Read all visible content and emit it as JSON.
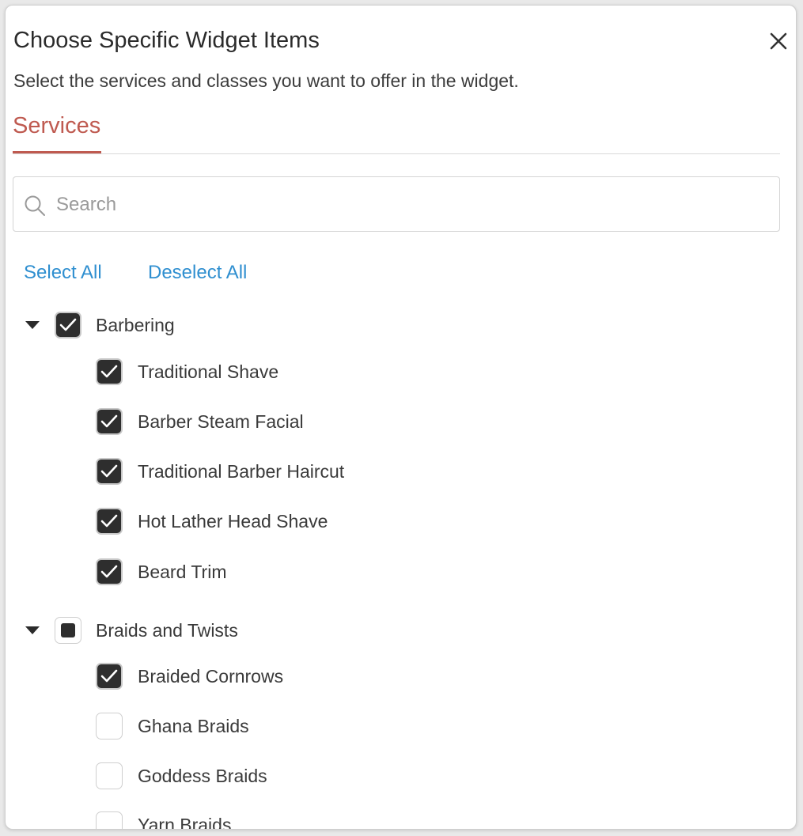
{
  "modal": {
    "title": "Choose Specific Widget Items",
    "subtitle": "Select the services and classes you want to offer in the widget.",
    "close_icon": "close-icon"
  },
  "tabs": [
    {
      "label": "Services",
      "active": true
    }
  ],
  "search": {
    "placeholder": "Search",
    "value": ""
  },
  "actions": {
    "select_all": "Select All",
    "deselect_all": "Deselect All"
  },
  "colors": {
    "accent": "#bf5a50",
    "link": "#2f8fd0",
    "checkbox_fill": "#2e2e2e"
  },
  "groups": [
    {
      "label": "Barbering",
      "state": "checked",
      "expanded": true,
      "items": [
        {
          "label": "Traditional Shave",
          "checked": true
        },
        {
          "label": "Barber Steam Facial",
          "checked": true
        },
        {
          "label": "Traditional Barber Haircut",
          "checked": true
        },
        {
          "label": "Hot Lather Head Shave",
          "checked": true
        },
        {
          "label": "Beard Trim",
          "checked": true
        }
      ]
    },
    {
      "label": "Braids and Twists",
      "state": "partial",
      "expanded": true,
      "items": [
        {
          "label": "Braided Cornrows",
          "checked": true
        },
        {
          "label": "Ghana Braids",
          "checked": false
        },
        {
          "label": "Goddess Braids",
          "checked": false
        },
        {
          "label": "Yarn Braids",
          "checked": false
        }
      ]
    }
  ]
}
